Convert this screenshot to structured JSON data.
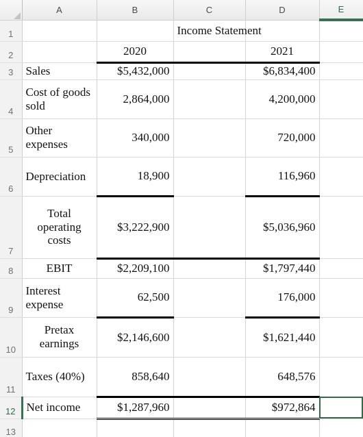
{
  "app": {
    "kind": "spreadsheet",
    "selected_cell": "E12",
    "selection_color": "#2f6b49"
  },
  "columns": [
    {
      "id": "corner",
      "label": ""
    },
    {
      "id": "A",
      "label": "A"
    },
    {
      "id": "B",
      "label": "B"
    },
    {
      "id": "C",
      "label": "C"
    },
    {
      "id": "D",
      "label": "D"
    },
    {
      "id": "E",
      "label": "E"
    }
  ],
  "rows": [
    {
      "num": "1",
      "a": "",
      "b": "",
      "c": "Income Statement",
      "d": "",
      "e": ""
    },
    {
      "num": "2",
      "a": "",
      "b": "2020",
      "c": "",
      "d": "2021",
      "e": ""
    },
    {
      "num": "3",
      "a": "Sales",
      "b": "$5,432,000",
      "c": "",
      "d": "$6,834,400",
      "e": ""
    },
    {
      "num": "4",
      "a": "Cost of goods sold",
      "b": "2,864,000",
      "c": "",
      "d": "4,200,000",
      "e": ""
    },
    {
      "num": "5",
      "a": "Other expenses",
      "b": "340,000",
      "c": "",
      "d": "720,000",
      "e": ""
    },
    {
      "num": "6",
      "a": "Depreciation",
      "b": "18,900",
      "c": "",
      "d": "116,960",
      "e": ""
    },
    {
      "num": "7",
      "a": "Total operating costs",
      "b": "$3,222,900",
      "c": "",
      "d": "$5,036,960",
      "e": ""
    },
    {
      "num": "8",
      "a": "EBIT",
      "b": "$2,209,100",
      "c": "",
      "d": "$1,797,440",
      "e": ""
    },
    {
      "num": "9",
      "a": "Interest expense",
      "b": "62,500",
      "c": "",
      "d": "176,000",
      "e": ""
    },
    {
      "num": "10",
      "a": "Pretax earnings",
      "b": "$2,146,600",
      "c": "",
      "d": "$1,621,440",
      "e": ""
    },
    {
      "num": "11",
      "a": "Taxes (40%)",
      "b": "858,640",
      "c": "",
      "d": "648,576",
      "e": ""
    },
    {
      "num": "12",
      "a": "Net income",
      "b": "$1,287,960",
      "c": "",
      "d": "$972,864",
      "e": ""
    },
    {
      "num": "13",
      "a": "",
      "b": "",
      "c": "",
      "d": "",
      "e": ""
    }
  ]
}
